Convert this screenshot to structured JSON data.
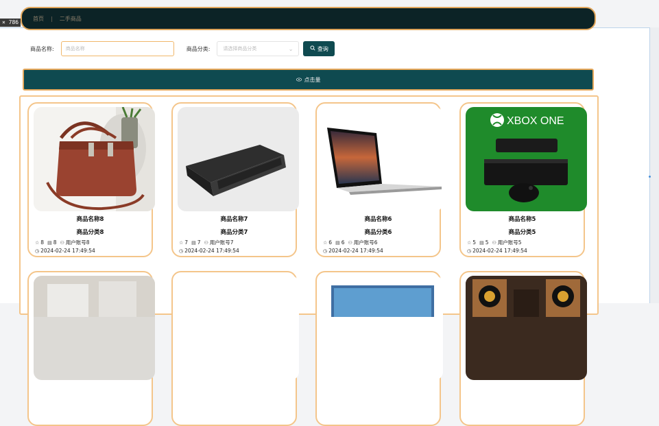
{
  "size_tag": "× 786",
  "breadcrumb": [
    "首页",
    "二手商品"
  ],
  "search": {
    "name_label": "商品名称:",
    "name_placeholder": "商品名称",
    "category_label": "商品分类:",
    "category_placeholder": "请选择商品分类",
    "query_button": "查询"
  },
  "action_bar": {
    "label": "点击量"
  },
  "products": [
    {
      "name": "商品名称8",
      "category": "商品分类8",
      "stars": "8",
      "comments": "8",
      "user": "用户账号8",
      "time": "2024-02-24 17:49:54",
      "image": "handbag"
    },
    {
      "name": "商品名称7",
      "category": "商品分类7",
      "stars": "7",
      "comments": "7",
      "user": "用户账号7",
      "time": "2024-02-24 17:49:54",
      "image": "laptop"
    },
    {
      "name": "商品名称6",
      "category": "商品分类6",
      "stars": "6",
      "comments": "6",
      "user": "用户账号6",
      "time": "2024-02-24 17:49:54",
      "image": "macbook"
    },
    {
      "name": "商品名称5",
      "category": "商品分类5",
      "stars": "5",
      "comments": "5",
      "user": "用户账号5",
      "time": "2024-02-24 17:49:54",
      "image": "xbox",
      "image_text": "XBOX ONE"
    }
  ],
  "colors": {
    "dark_teal": "#0f4a50",
    "navbar": "#0c2326",
    "accent_border": "#f4c58a"
  }
}
